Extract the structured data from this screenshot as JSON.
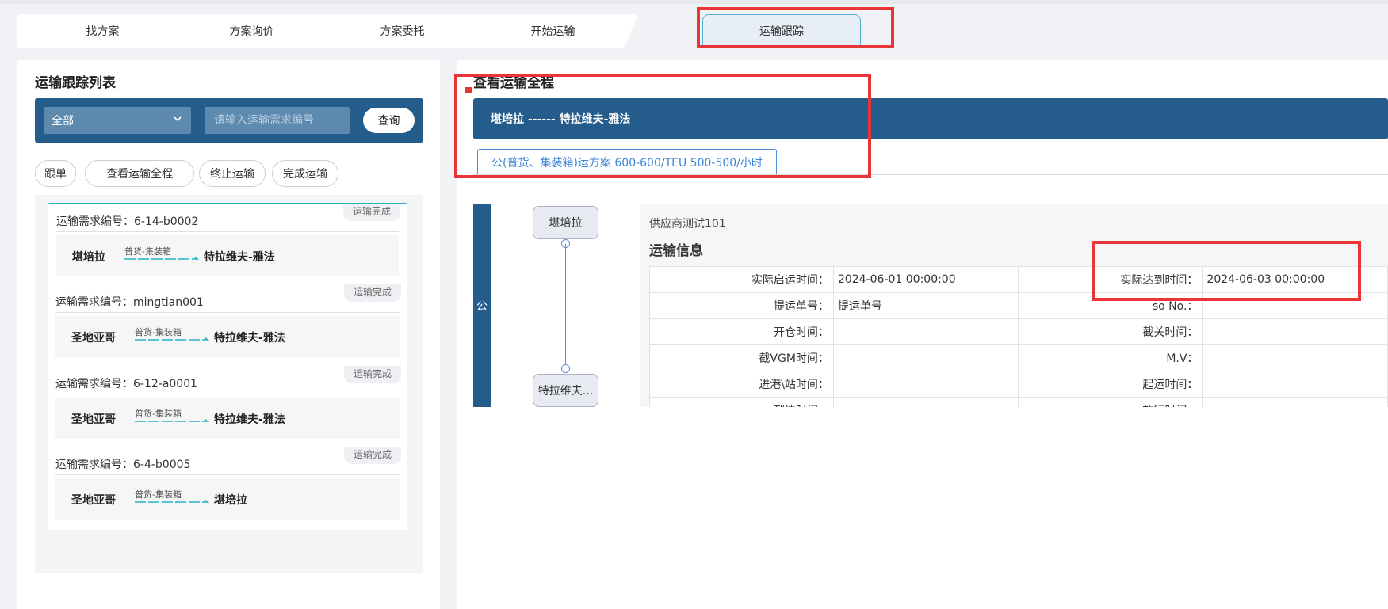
{
  "steps": [
    "找方案",
    "方案询价",
    "方案委托",
    "开始运输",
    "运输跟踪"
  ],
  "left": {
    "title": "运输跟踪列表",
    "filter": {
      "selected": "全部",
      "placeholder": "请输入运输需求编号",
      "query_label": "查询"
    },
    "actions": [
      "跟单",
      "查看运输全程",
      "终止运输",
      "完成运输"
    ],
    "cards": [
      {
        "status": "运输完成",
        "number": "运输需求编号：6-14-b0002",
        "from": "堪培拉",
        "cargo": "普货-集装箱",
        "to": "特拉维夫-雅法"
      },
      {
        "status": "运输完成",
        "number": "运输需求编号：mingtian001",
        "from": "圣地亚哥",
        "cargo": "普货-集装箱",
        "to": "特拉维夫-雅法"
      },
      {
        "status": "运输完成",
        "number": "运输需求编号：6-12-a0001",
        "from": "圣地亚哥",
        "cargo": "普货-集装箱",
        "to": "特拉维夫-雅法"
      },
      {
        "status": "运输完成",
        "number": "运输需求编号：6-4-b0005",
        "from": "圣地亚哥",
        "cargo": "普货-集装箱",
        "to": "堪培拉"
      }
    ]
  },
  "right": {
    "title": "查看运输全程",
    "route_header": "堪培拉 ------ 特拉维夫-雅法",
    "plan_tab": "公(普货、集装箱)运方案 600-600/TEU 500-500/小时",
    "stage_label": "公",
    "nodes": [
      "堪培拉",
      "特拉维夫..."
    ],
    "supplier": "供应商测试101",
    "info_title": "运输信息",
    "rows": [
      [
        "实际启运时间：",
        "2024-06-01 00:00:00",
        "实际达到时间：",
        "2024-06-03 00:00:00"
      ],
      [
        "提运单号：",
        "提运单号",
        "so No.：",
        ""
      ],
      [
        "开仓时间：",
        "",
        "截关时间：",
        ""
      ],
      [
        "截VGM时间：",
        "",
        "M.V：",
        ""
      ],
      [
        "进港\\站时间：",
        "",
        "起运时间：",
        ""
      ],
      [
        "到达时间：",
        "",
        "放行时间：",
        ""
      ]
    ]
  },
  "colors": {
    "accent": "#245c8c",
    "highlight": "#e83535",
    "selected_border": "#27b3c4"
  }
}
